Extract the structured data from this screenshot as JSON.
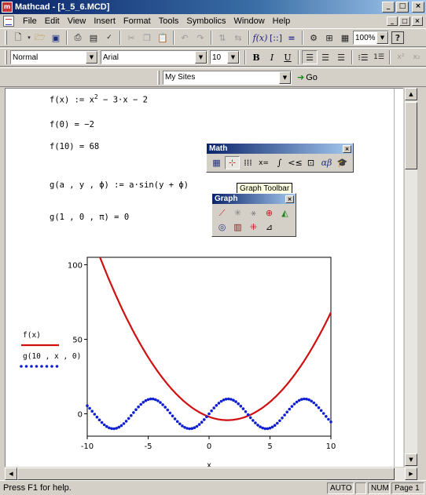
{
  "window": {
    "title": "Mathcad - [1_5_6.MCD]",
    "minimize": "_",
    "maximize": "□",
    "close": "×"
  },
  "menu": [
    "File",
    "Edit",
    "View",
    "Insert",
    "Format",
    "Tools",
    "Symbolics",
    "Window",
    "Help"
  ],
  "menu_child_buttons": {
    "minimize": "_",
    "restore": "□",
    "close": "×"
  },
  "toolbar": {
    "zoom": "100%",
    "help_icon": "?",
    "icons": [
      "new-doc-icon",
      "open-folder-icon",
      "save-icon",
      "print-icon",
      "print-preview-icon",
      "spell-check-icon",
      "cut-icon",
      "copy-icon",
      "paste-icon",
      "undo-icon",
      "redo-icon",
      "align-icon",
      "insert-graph-icon",
      "insert-matrix-icon",
      "insert-function-icon",
      "insert-unit-icon",
      "calculate-icon",
      "insert-component-icon",
      "resources-icon"
    ]
  },
  "format_bar": {
    "style": "Normal",
    "font": "Arial",
    "size": "10",
    "bold": "B",
    "italic": "I",
    "underline": "U"
  },
  "web_bar": {
    "location": "My Sites",
    "go_label": "Go"
  },
  "worksheet": {
    "f_def_lhs": "f(x) := x",
    "f_def_exp": "2",
    "f_def_rhs": " − 3·x − 2",
    "f0": "f(0) = −2",
    "f10": "f(10) = 68",
    "g_def": "g(a , y , ϕ) := a·sin(y + ϕ)",
    "g_eval": "g(1 , 0 , π) = 0"
  },
  "math_palette": {
    "title": "Math",
    "icons": [
      "calculator-icon",
      "graph-icon",
      "matrix-icon",
      "evaluation-icon",
      "calculus-icon",
      "boolean-icon",
      "programming-icon",
      "greek-icon",
      "symbolic-icon"
    ],
    "tooltip": "Graph Toolbar"
  },
  "graph_palette": {
    "title": "Graph",
    "icons": [
      "xy-plot-icon",
      "polar-plot-icon",
      "surface-plot-icon",
      "contour-plot-icon",
      "3d-scatter-icon",
      "3d-bar-icon",
      "vector-field-icon",
      "zoom-icon",
      "trace-icon"
    ]
  },
  "chart_data": {
    "type": "line",
    "x_range": [
      -10,
      10
    ],
    "y_range": [
      -15,
      105
    ],
    "xticks": [
      -10,
      -5,
      0,
      5,
      10
    ],
    "yticks": [
      0,
      50,
      100
    ],
    "xlabel": "x",
    "series": [
      {
        "name": "f(x)",
        "formula": "x^2 - 3x - 2",
        "color": "#d01010",
        "style": "solid"
      },
      {
        "name": "g(10 , x , 0)",
        "formula": "10*sin(x)",
        "color": "#1020d0",
        "style": "dotted"
      }
    ]
  },
  "status": {
    "help": "Press F1 for help.",
    "mode": "AUTO",
    "num": "NUM",
    "page": "Page 1"
  }
}
